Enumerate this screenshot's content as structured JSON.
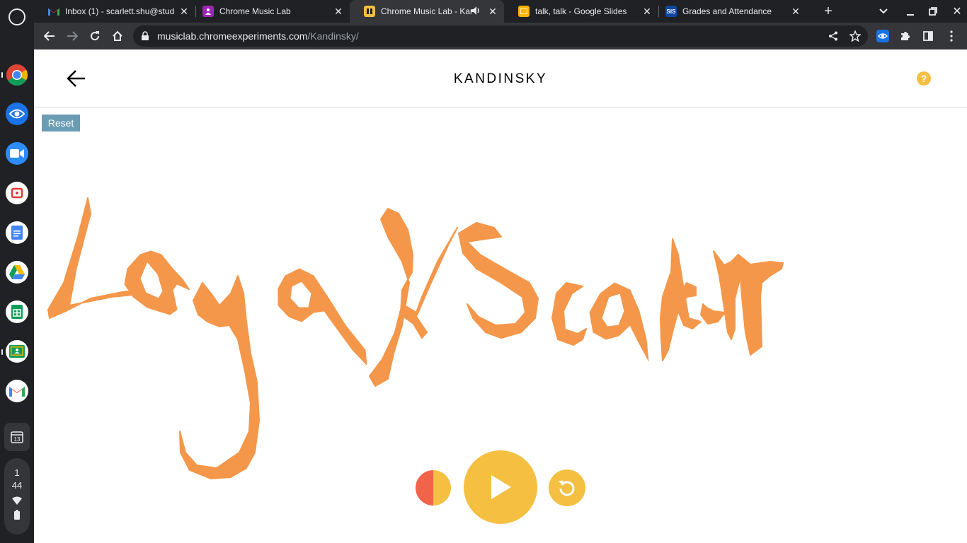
{
  "shelf": {
    "apps": [
      {
        "name": "chrome-icon"
      },
      {
        "name": "eye-icon"
      },
      {
        "name": "zoom-icon"
      },
      {
        "name": "screencastify-icon"
      },
      {
        "name": "docs-icon"
      },
      {
        "name": "drive-icon"
      },
      {
        "name": "sheets-icon"
      },
      {
        "name": "classroom-icon"
      },
      {
        "name": "gmail-icon"
      }
    ],
    "calendar_day": "13",
    "time_hour": "1",
    "time_minute": "44"
  },
  "browser": {
    "tabs": [
      {
        "title": "Inbox (1) - scarlett.shu@stud",
        "favicon": "gmail-icon",
        "active": false
      },
      {
        "title": "Chrome Music Lab",
        "favicon": "music-lab-icon",
        "active": false
      },
      {
        "title": "Chrome Music Lab - Kan",
        "favicon": "kandinsky-icon",
        "active": true
      },
      {
        "title": "talk, talk - Google Slides",
        "favicon": "slides-icon",
        "active": false
      },
      {
        "title": "Grades and Attendance",
        "favicon": "sis-icon",
        "active": false
      }
    ],
    "sis_label": "SIS",
    "url_host": "musiclab.chromeexperiments.com",
    "url_path": "/Kandinsky/"
  },
  "page": {
    "title": "KANDINSKY",
    "help_label": "?",
    "reset_label": "Reset"
  },
  "colors": {
    "stroke_orange": "#f4974a",
    "yellow": "#f5bf42",
    "red": "#f2644a",
    "reset_blue": "#6a9cb3"
  }
}
